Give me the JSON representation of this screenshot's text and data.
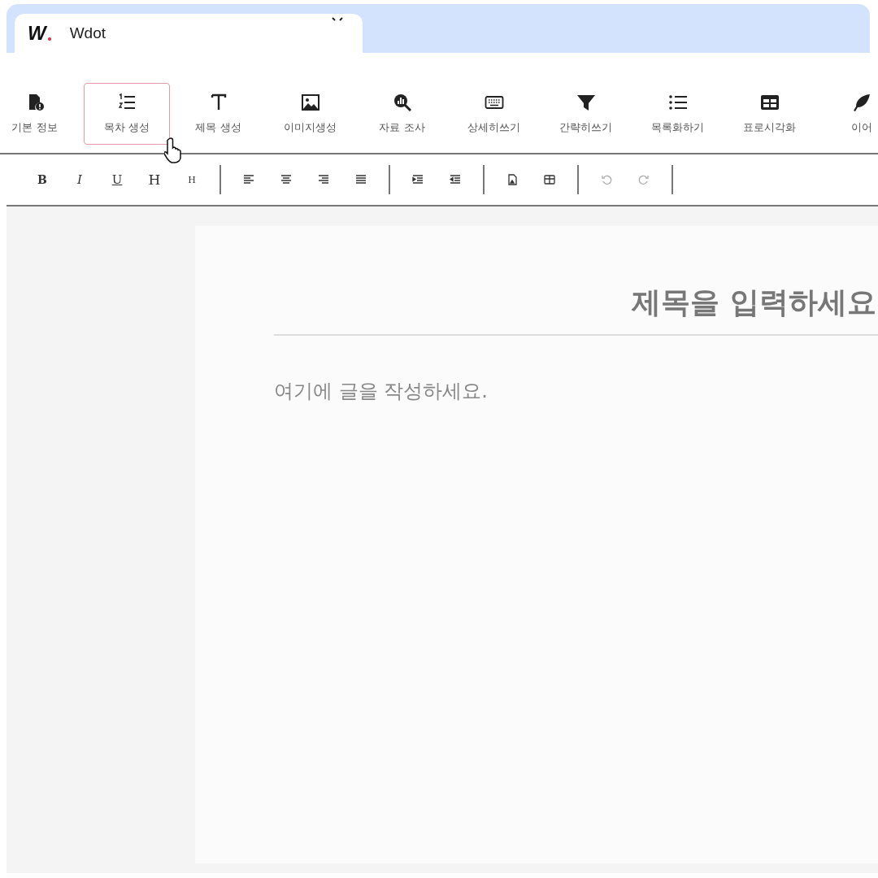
{
  "browser_tab": {
    "logo_text": "W",
    "title": "Wdot"
  },
  "tools": [
    {
      "kind": "document",
      "label": "기본 정보",
      "selected": false
    },
    {
      "kind": "numbered",
      "label": "목차 생성",
      "selected": true
    },
    {
      "kind": "text",
      "label": "제목 생성",
      "selected": false
    },
    {
      "kind": "image",
      "label": "이미지생성",
      "selected": false
    },
    {
      "kind": "search",
      "label": "자료 조사",
      "selected": false
    },
    {
      "kind": "keyboard",
      "label": "상세히쓰기",
      "selected": false
    },
    {
      "kind": "filter",
      "label": "간략히쓰기",
      "selected": false
    },
    {
      "kind": "list",
      "label": "목록화하기",
      "selected": false
    },
    {
      "kind": "table",
      "label": "표로시각화",
      "selected": false
    },
    {
      "kind": "feather",
      "label": "이어",
      "selected": false
    }
  ],
  "format_toolbar": [
    [
      {
        "kind": "bold",
        "label": "B",
        "disabled": false
      },
      {
        "kind": "italic",
        "label": "I",
        "disabled": false
      },
      {
        "kind": "underline",
        "label": "U",
        "disabled": false
      },
      {
        "kind": "heading",
        "label": "H",
        "disabled": false
      },
      {
        "kind": "subheading",
        "label": "H",
        "disabled": false
      }
    ],
    [
      {
        "kind": "left",
        "disabled": false
      },
      {
        "kind": "center",
        "disabled": false
      },
      {
        "kind": "right",
        "disabled": false
      },
      {
        "kind": "justify",
        "disabled": false
      }
    ],
    [
      {
        "kind": "indent",
        "disabled": false
      },
      {
        "kind": "outdent",
        "disabled": false
      }
    ],
    [
      {
        "kind": "image",
        "disabled": false
      },
      {
        "kind": "table",
        "disabled": false
      }
    ],
    [
      {
        "kind": "undo",
        "disabled": true
      },
      {
        "kind": "redo",
        "disabled": true
      }
    ]
  ],
  "editor": {
    "title_placeholder": "제목을 입력하세요",
    "body_placeholder": "여기에 글을 작성하세요."
  }
}
